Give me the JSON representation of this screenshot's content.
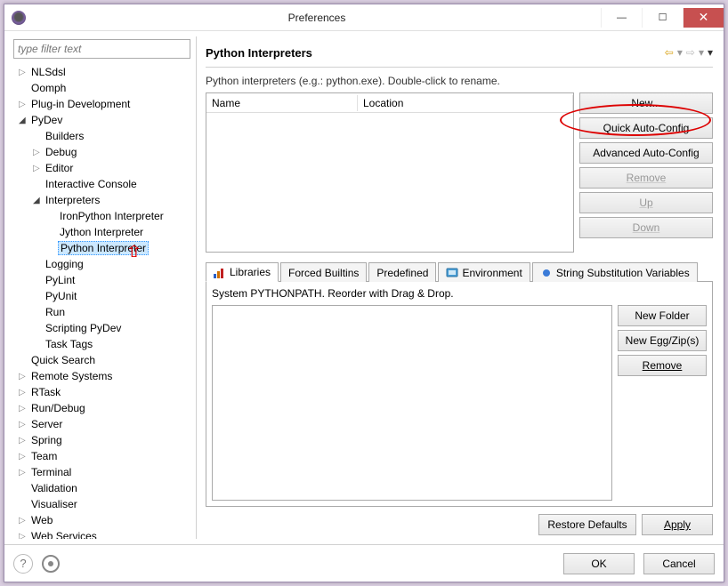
{
  "window": {
    "title": "Preferences"
  },
  "filter_placeholder": "type filter text",
  "tree": [
    {
      "depth": 0,
      "arrow": "▷",
      "label": "NLSdsl"
    },
    {
      "depth": 0,
      "arrow": "",
      "label": "Oomph"
    },
    {
      "depth": 0,
      "arrow": "▷",
      "label": "Plug-in Development"
    },
    {
      "depth": 0,
      "arrow": "◢",
      "label": "PyDev"
    },
    {
      "depth": 1,
      "arrow": "",
      "label": "Builders"
    },
    {
      "depth": 1,
      "arrow": "▷",
      "label": "Debug"
    },
    {
      "depth": 1,
      "arrow": "▷",
      "label": "Editor"
    },
    {
      "depth": 1,
      "arrow": "",
      "label": "Interactive Console"
    },
    {
      "depth": 1,
      "arrow": "◢",
      "label": "Interpreters"
    },
    {
      "depth": 2,
      "arrow": "",
      "label": "IronPython Interpreter"
    },
    {
      "depth": 2,
      "arrow": "",
      "label": "Jython Interpreter"
    },
    {
      "depth": 2,
      "arrow": "",
      "label": "Python Interpreter",
      "selected": true
    },
    {
      "depth": 1,
      "arrow": "",
      "label": "Logging"
    },
    {
      "depth": 1,
      "arrow": "",
      "label": "PyLint"
    },
    {
      "depth": 1,
      "arrow": "",
      "label": "PyUnit"
    },
    {
      "depth": 1,
      "arrow": "",
      "label": "Run"
    },
    {
      "depth": 1,
      "arrow": "",
      "label": "Scripting PyDev"
    },
    {
      "depth": 1,
      "arrow": "",
      "label": "Task Tags"
    },
    {
      "depth": 0,
      "arrow": "",
      "label": "Quick Search"
    },
    {
      "depth": 0,
      "arrow": "▷",
      "label": "Remote Systems"
    },
    {
      "depth": 0,
      "arrow": "▷",
      "label": "RTask"
    },
    {
      "depth": 0,
      "arrow": "▷",
      "label": "Run/Debug"
    },
    {
      "depth": 0,
      "arrow": "▷",
      "label": "Server"
    },
    {
      "depth": 0,
      "arrow": "▷",
      "label": "Spring"
    },
    {
      "depth": 0,
      "arrow": "▷",
      "label": "Team"
    },
    {
      "depth": 0,
      "arrow": "▷",
      "label": "Terminal"
    },
    {
      "depth": 0,
      "arrow": "",
      "label": "Validation"
    },
    {
      "depth": 0,
      "arrow": "",
      "label": "Visualiser"
    },
    {
      "depth": 0,
      "arrow": "▷",
      "label": "Web"
    },
    {
      "depth": 0,
      "arrow": "▷",
      "label": "Web Services"
    }
  ],
  "page": {
    "title": "Python Interpreters",
    "desc": "Python interpreters (e.g.: python.exe).   Double-click to rename."
  },
  "interp_columns": {
    "name": "Name",
    "location": "Location"
  },
  "interp_buttons": {
    "new": "New...",
    "quick": "Quick Auto-Config",
    "advanced": "Advanced Auto-Config",
    "remove": "Remove",
    "up": "Up",
    "down": "Down"
  },
  "tabs": {
    "libraries": "Libraries",
    "forced": "Forced Builtins",
    "predefined": "Predefined",
    "environment": "Environment",
    "stringsub": "String Substitution Variables"
  },
  "pythonpath": {
    "desc": "System PYTHONPATH.   Reorder with Drag & Drop.",
    "buttons": {
      "newfolder": "New Folder",
      "newegg": "New Egg/Zip(s)",
      "remove": "Remove"
    }
  },
  "lower_buttons": {
    "restore": "Restore Defaults",
    "apply": "Apply"
  },
  "bottom": {
    "ok": "OK",
    "cancel": "Cancel"
  }
}
